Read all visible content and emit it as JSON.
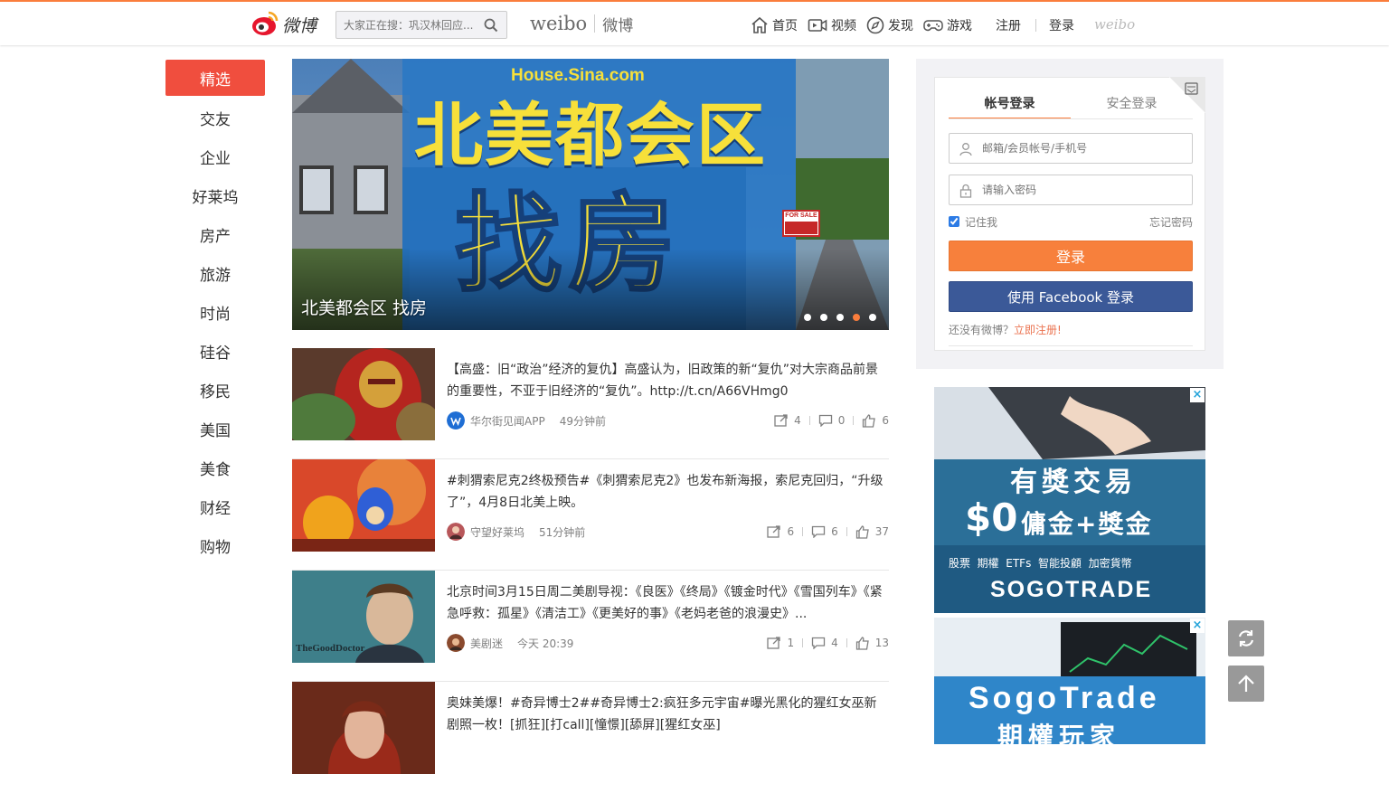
{
  "header": {
    "search_placeholder": "大家正在搜：巩汉林回应...",
    "brand_en": "weibo",
    "brand_cn": "微博",
    "logo_text": "微博",
    "nav": [
      {
        "label": "首页",
        "icon": "home-icon"
      },
      {
        "label": "视频",
        "icon": "video-icon"
      },
      {
        "label": "发现",
        "icon": "compass-icon"
      },
      {
        "label": "游戏",
        "icon": "gamepad-icon"
      }
    ],
    "register_label": "注册",
    "login_label": "登录",
    "weibo_mark": "weibo"
  },
  "channels": [
    "精选",
    "交友",
    "企业",
    "好莱坞",
    "房产",
    "旅游",
    "时尚",
    "硅谷",
    "移民",
    "美国",
    "美食",
    "财经",
    "购物"
  ],
  "banner": {
    "site": "House.Sina.com",
    "headline_top": "北美都会区",
    "headline_big": "找房",
    "sign": "FOR SALE",
    "caption": "北美都会区 找房",
    "dots": 5,
    "active_dot": 3
  },
  "feed": [
    {
      "text": "【高盛：旧“政治”经济的复仇】高盛认为，旧政策的新“复仇”对大宗商品前景的重要性，不亚于旧经济的“复仇”。http://t.cn/A66VHmg0",
      "author": "华尔街见闻APP",
      "time": "49分钟前",
      "reposts": "4",
      "comments": "0",
      "likes": "6"
    },
    {
      "text": "#刺猬索尼克2终极预告#《刺猬索尼克2》也发布新海报，索尼克回归，“升级了”，4月8日北美上映。",
      "author": "守望好莱坞",
      "time": "51分钟前",
      "reposts": "6",
      "comments": "6",
      "likes": "37"
    },
    {
      "text": "北京时间3月15日周二美剧导视：《良医》《终局》《镀金时代》《雪国列车》《紧急呼救：孤星》《清洁工》《更美好的事》《老妈老爸的浪漫史》...",
      "author": "美剧迷",
      "time": "今天 20:39",
      "reposts": "1",
      "comments": "4",
      "likes": "13"
    },
    {
      "text": "奥妹美爆！#奇异博士2##奇异博士2:疯狂多元宇宙#曝光黑化的猩红女巫新剧照一枚！[抓狂][打call][憧憬][舔屏][猩红女巫]",
      "author": "",
      "time": "",
      "reposts": "",
      "comments": "",
      "likes": ""
    }
  ],
  "thumb_labels": {
    "good_doctor": "TheGoodDoctor"
  },
  "login": {
    "tab_account": "帐号登录",
    "tab_secure": "安全登录",
    "username_placeholder": "邮箱/会员帐号/手机号",
    "password_placeholder": "请输入密码",
    "remember": "记住我",
    "forgot": "忘记密码",
    "login_button": "登录",
    "facebook_button": "使用 Facebook 登录",
    "signup_prompt": "还没有微博？",
    "signup_link": "立即注册!"
  },
  "ads": [
    {
      "line1": "有獎交易",
      "price": "$0",
      "line2": "傭金+獎金",
      "tags": "股票  期權  ETFs  智能投顧  加密貨幣",
      "brand": "SOGOTRADE"
    },
    {
      "line1": "SogoTrade",
      "line2": "期權玩家"
    }
  ],
  "colors": {
    "accent": "#fa7d3c",
    "channel_active": "#f04e3e",
    "facebook": "#3b5998",
    "link": "#eb7350"
  }
}
